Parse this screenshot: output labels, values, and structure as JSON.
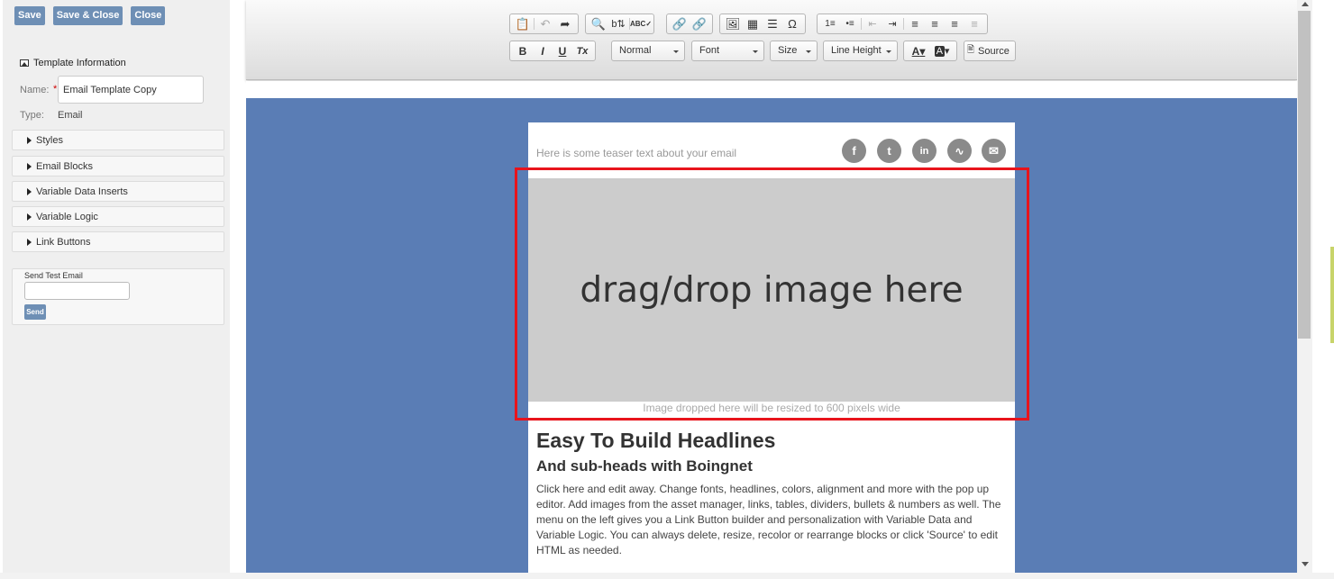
{
  "sidebar": {
    "buttons": {
      "save": "Save",
      "save_close": "Save & Close",
      "close": "Close"
    },
    "template_info": {
      "title": "Template Information",
      "icon": "picture-icon",
      "name_label": "Name:",
      "required_mark": "*",
      "name_value": "Email Template Copy",
      "type_label": "Type:",
      "type_value": "Email"
    },
    "accordion": [
      "Styles",
      "Email Blocks",
      "Variable Data Inserts",
      "Variable Logic",
      "Link Buttons"
    ],
    "send_test": {
      "title": "Send Test Email",
      "email_value": "",
      "send_label": "Send"
    }
  },
  "toolbar": {
    "row1_icons": [
      "paste-icon",
      "undo-icon",
      "redo-icon",
      "find-icon",
      "replace-icon",
      "spellcheck-icon",
      "link-icon",
      "unlink-icon",
      "image-icon",
      "table-icon",
      "horizontal-line-icon",
      "special-char-icon",
      "numbered-list-icon",
      "bulleted-list-icon",
      "outdent-icon",
      "indent-icon",
      "align-left-icon",
      "align-center-icon",
      "align-right-icon",
      "justify-icon"
    ],
    "format": "Normal",
    "font": "Font",
    "size": "Size",
    "line_height": "Line Height",
    "source": "Source",
    "bold": "B",
    "italic": "I",
    "underline": "U",
    "clear_format": "Tx",
    "text_color": "A",
    "bg_color": "A"
  },
  "email": {
    "teaser": "Here is some teaser text about your email",
    "social_icons": [
      "facebook-icon",
      "tumblr-icon",
      "linkedin-icon",
      "rss-icon",
      "email-icon"
    ],
    "drop_text": "drag/drop image here",
    "drop_caption": "Image dropped here will be resized to 600 pixels wide",
    "headline": "Easy To Build Headlines",
    "subhead": "And sub-heads with Boingnet",
    "body": "Click here and edit away. Change fonts, headlines, colors, alignment and more with the pop up editor. Add images from the asset manager, links, tables, dividers, bullets & numbers as well. The menu on the left gives you a Link Button builder and personalization with Variable Data and Variable Logic. You can always delete, resize, recolor or rearrange blocks or click 'Source' to edit HTML as needed."
  },
  "colors": {
    "canvas_bg": "#5a7db5",
    "button_bg": "#6e8fb5",
    "highlight_border": "#e8141c",
    "drop_zone_bg": "#cccccc"
  }
}
